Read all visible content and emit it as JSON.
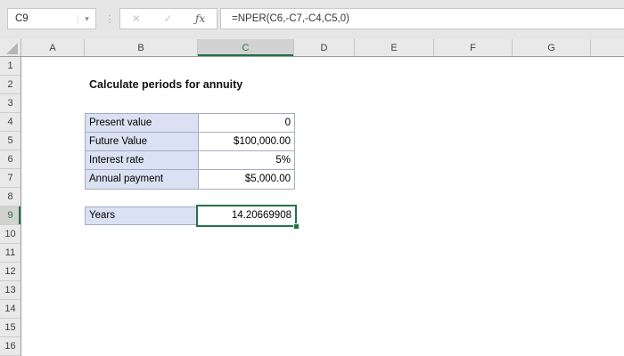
{
  "formula_bar": {
    "name_box_value": "C9",
    "dropdown_icon": "▾",
    "separator_icon": "⋮",
    "cancel_icon": "✕",
    "enter_icon": "✓",
    "fx_icon": "ƒx",
    "formula": "=NPER(C6,-C7,-C4,C5,0)"
  },
  "grid": {
    "columns": [
      "A",
      "B",
      "C",
      "D",
      "E",
      "F",
      "G"
    ],
    "rows": [
      "1",
      "2",
      "3",
      "4",
      "5",
      "6",
      "7",
      "8",
      "9",
      "10",
      "11",
      "12",
      "13",
      "14",
      "15",
      "16"
    ],
    "selected_cell": "C9",
    "selected_column": "C",
    "selected_row": "9"
  },
  "sheet": {
    "title": "Calculate periods for annuity",
    "table": {
      "rows": [
        {
          "label": "Present value",
          "value": "0"
        },
        {
          "label": "Future Value",
          "value": "$100,000.00"
        },
        {
          "label": "Interest rate",
          "value": "5%"
        },
        {
          "label": "Annual payment",
          "value": "$5,000.00"
        }
      ]
    },
    "result": {
      "label": "Years",
      "value": "14.20669908"
    }
  },
  "colors": {
    "accent_green": "#217346",
    "label_fill": "#D9E1F2",
    "table_border": "#A3ADBF",
    "chrome_background": "#E6E6E6"
  }
}
